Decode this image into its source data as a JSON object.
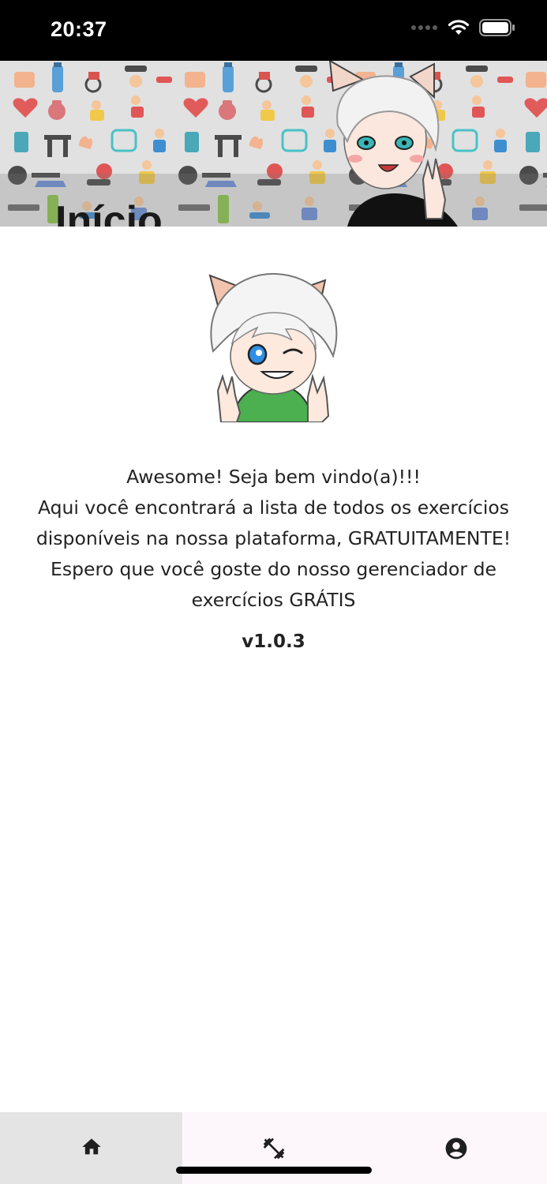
{
  "status_bar": {
    "time": "20:37",
    "icons": [
      "signal-dots-icon",
      "wifi-icon",
      "battery-icon"
    ]
  },
  "header": {
    "title": "Início",
    "background": "fitness-pattern",
    "avatar": "cat-ear-character-avatar"
  },
  "main": {
    "mascot": "cat-ear-character-waving",
    "welcome_lines": [
      "Awesome! Seja bem vindo(a)!!!",
      "Aqui você encontrará a lista de todos os exercícios",
      "disponíveis na nossa plataforma, GRATUITAMENTE!",
      "Espero que você goste do nosso gerenciador de",
      "exercícios GRÁTIS"
    ],
    "version": "v1.0.3"
  },
  "bottom_nav": {
    "items": [
      {
        "icon": "home-icon",
        "active": true
      },
      {
        "icon": "dumbbell-icon",
        "active": false
      },
      {
        "icon": "account-circle-icon",
        "active": false
      }
    ]
  },
  "colors": {
    "status_bar": "#000000",
    "nav_background": "#fdf7fb",
    "nav_active": "#e4e4e4",
    "shirt_green": "#4caf50"
  }
}
